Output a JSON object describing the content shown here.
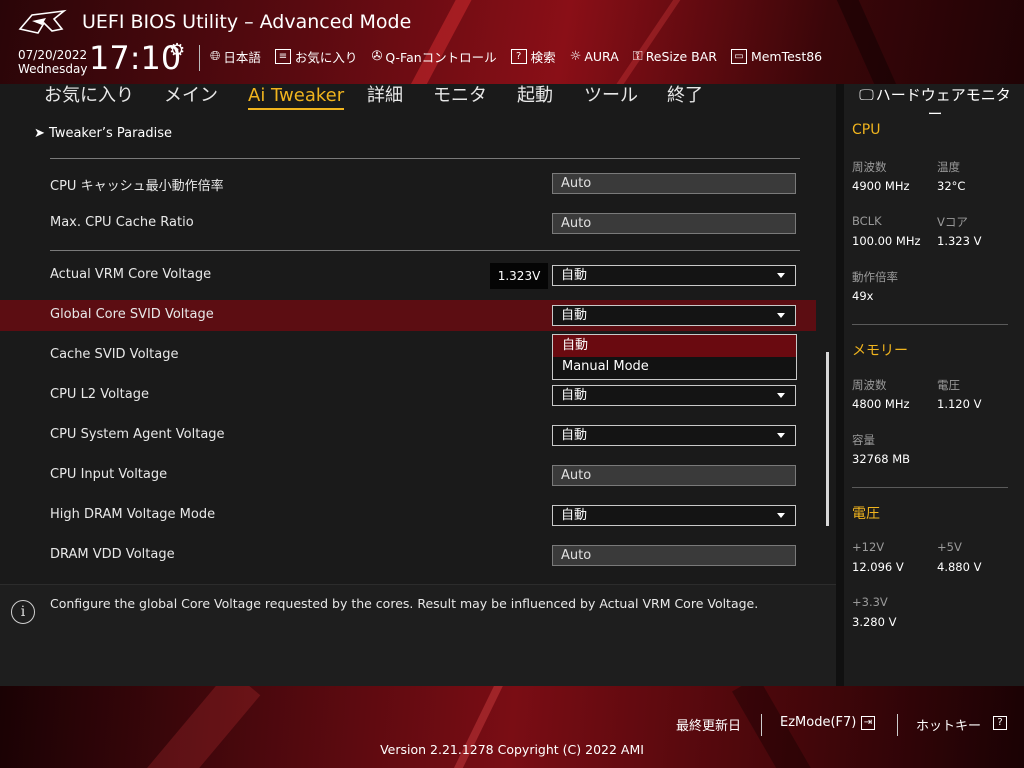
{
  "header": {
    "app_title": "UEFI BIOS Utility – Advanced Mode",
    "date": "07/20/2022",
    "weekday": "Wednesday",
    "time": "17:10",
    "toolbar": [
      {
        "label": "日本語",
        "icon": "globe-icon"
      },
      {
        "label": "お気に入り",
        "icon": "favorites-icon"
      },
      {
        "label": "Q-Fanコントロール",
        "icon": "fan-icon"
      },
      {
        "label": "検索",
        "icon": "search-icon"
      },
      {
        "label": "AURA",
        "icon": "aura-icon"
      },
      {
        "label": "ReSize BAR",
        "icon": "resize-bar-icon"
      },
      {
        "label": "MemTest86",
        "icon": "memtest-icon"
      }
    ]
  },
  "nav": {
    "tabs": [
      {
        "label": "お気に入り",
        "active": false
      },
      {
        "label": "メイン",
        "active": false
      },
      {
        "label": "Ai Tweaker",
        "active": true
      },
      {
        "label": "詳細",
        "active": false
      },
      {
        "label": "モニタ",
        "active": false
      },
      {
        "label": "起動",
        "active": false
      },
      {
        "label": "ツール",
        "active": false
      },
      {
        "label": "終了",
        "active": false
      }
    ]
  },
  "main": {
    "breadcrumb": "Tweaker’s Paradise",
    "rows": [
      {
        "label": "CPU キャッシュ最小動作倍率",
        "value": "Auto",
        "kind": "static"
      },
      {
        "label": "Max. CPU Cache Ratio",
        "value": "Auto",
        "kind": "static"
      },
      {
        "label": "Actual VRM Core Voltage",
        "value": "自動",
        "kind": "select",
        "readout": "1.323V"
      },
      {
        "label": "Global Core SVID Voltage",
        "value": "自動",
        "kind": "select",
        "selected": true
      },
      {
        "label": "Cache SVID Voltage",
        "value": "",
        "kind": "none"
      },
      {
        "label": "CPU L2 Voltage",
        "value": "自動",
        "kind": "select"
      },
      {
        "label": "CPU System Agent Voltage",
        "value": "自動",
        "kind": "select"
      },
      {
        "label": "CPU Input Voltage",
        "value": "Auto",
        "kind": "static"
      },
      {
        "label": "High DRAM Voltage Mode",
        "value": "自動",
        "kind": "select"
      },
      {
        "label": "DRAM VDD Voltage",
        "value": "Auto",
        "kind": "static"
      }
    ],
    "dropdown_options": [
      "自動",
      "Manual Mode"
    ]
  },
  "info": {
    "text": "Configure the global Core Voltage requested by the cores. Result may be influenced by Actual VRM Core Voltage."
  },
  "monitor": {
    "title": "ハードウェアモニター",
    "cpu": {
      "section": "CPU",
      "freq_label": "周波数",
      "freq_value": "4900 MHz",
      "temp_label": "温度",
      "temp_value": "32°C",
      "bclk_label": "BCLK",
      "bclk_value": "100.00 MHz",
      "vcore_label": "Vコア",
      "vcore_value": "1.323 V",
      "ratio_label": "動作倍率",
      "ratio_value": "49x"
    },
    "memory": {
      "section": "メモリー",
      "freq_label": "周波数",
      "freq_value": "4800 MHz",
      "volt_label": "電圧",
      "volt_value": "1.120 V",
      "cap_label": "容量",
      "cap_value": "32768 MB"
    },
    "voltage": {
      "section": "電圧",
      "v12_label": "+12V",
      "v12_value": "12.096 V",
      "v5_label": "+5V",
      "v5_value": "4.880 V",
      "v33_label": "+3.3V",
      "v33_value": "3.280 V"
    }
  },
  "footer": {
    "last_modified": "最終更新日",
    "ezmode": "EzMode(F7)",
    "hotkeys": "ホットキー",
    "version": "Version 2.21.1278 Copyright (C) 2022 AMI"
  },
  "colors": {
    "accent": "#f0b41e",
    "selected_row": "#5c0d12",
    "brand_red": "#8a0f17"
  }
}
